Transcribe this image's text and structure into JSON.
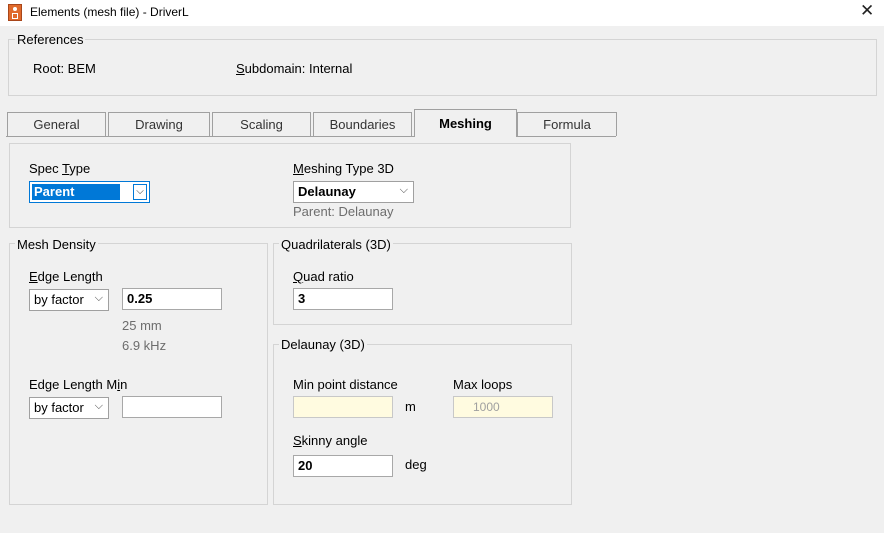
{
  "window": {
    "title": "Elements (mesh file) - DriverL",
    "close_glyph": "✕"
  },
  "references": {
    "legend": "References",
    "root": "Root: BEM",
    "subdomain_key": "S",
    "subdomain_rest": "ubdomain: Internal"
  },
  "tabs": [
    {
      "label": "General"
    },
    {
      "label": "Drawing"
    },
    {
      "label": "Scaling"
    },
    {
      "label": "Boundaries"
    },
    {
      "label": "Meshing",
      "active": true
    },
    {
      "label": "Formula"
    }
  ],
  "spec": {
    "label_pre": "Spec ",
    "label_key": "T",
    "label_post": "ype",
    "value": "Parent"
  },
  "meshing_type": {
    "label_key": "M",
    "label_rest": "eshing Type 3D",
    "value": "Delaunay",
    "parent_note": "Parent: Delaunay"
  },
  "mesh_density": {
    "legend": "Mesh Density",
    "edge_length": {
      "label_key": "E",
      "label_rest": "dge Length",
      "mode": "by factor",
      "value": "0.25",
      "info1": "25 mm",
      "info2": "6.9 kHz"
    },
    "edge_length_min": {
      "label_pre": "Edge Length M",
      "label_key": "i",
      "label_post": "n",
      "mode": "by factor",
      "value": ""
    }
  },
  "quadrilaterals": {
    "legend": "Quadrilaterals (3D)",
    "label_key": "Q",
    "label_rest": "uad ratio",
    "value": "3"
  },
  "delaunay": {
    "legend": "Delaunay (3D)",
    "min_point_distance": {
      "label": "Min point distance",
      "value": "",
      "unit": "m"
    },
    "max_loops": {
      "label": "Max loops",
      "placeholder": "1000"
    },
    "skinny_angle": {
      "label_key": "S",
      "label_rest": "kinny angle",
      "value": "20",
      "unit": "deg"
    }
  },
  "colors": {
    "readonly_field": "#fffbe0",
    "selection": "#0078d7"
  },
  "icons": {
    "dropdown": "chevron-down-icon",
    "app": "app-icon",
    "close": "close-icon"
  }
}
